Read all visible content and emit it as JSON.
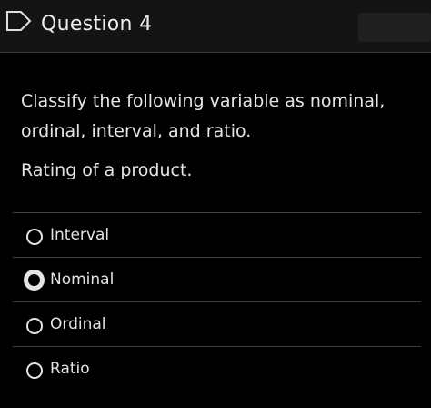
{
  "header": {
    "title": "Question 4",
    "icon": "flag-icon"
  },
  "question": {
    "prompt_line1": "Classify the following variable as nominal,",
    "prompt_line2": "ordinal, interval, and ratio.",
    "variable": "Rating of a product."
  },
  "options": [
    {
      "label": "Interval",
      "selected": false
    },
    {
      "label": "Nominal",
      "selected": true
    },
    {
      "label": "Ordinal",
      "selected": false
    },
    {
      "label": "Ratio",
      "selected": false
    }
  ],
  "colors": {
    "background": "#000000",
    "header_background": "#141414",
    "text": "#e6e6e6",
    "divider": "#3d3d3d"
  }
}
